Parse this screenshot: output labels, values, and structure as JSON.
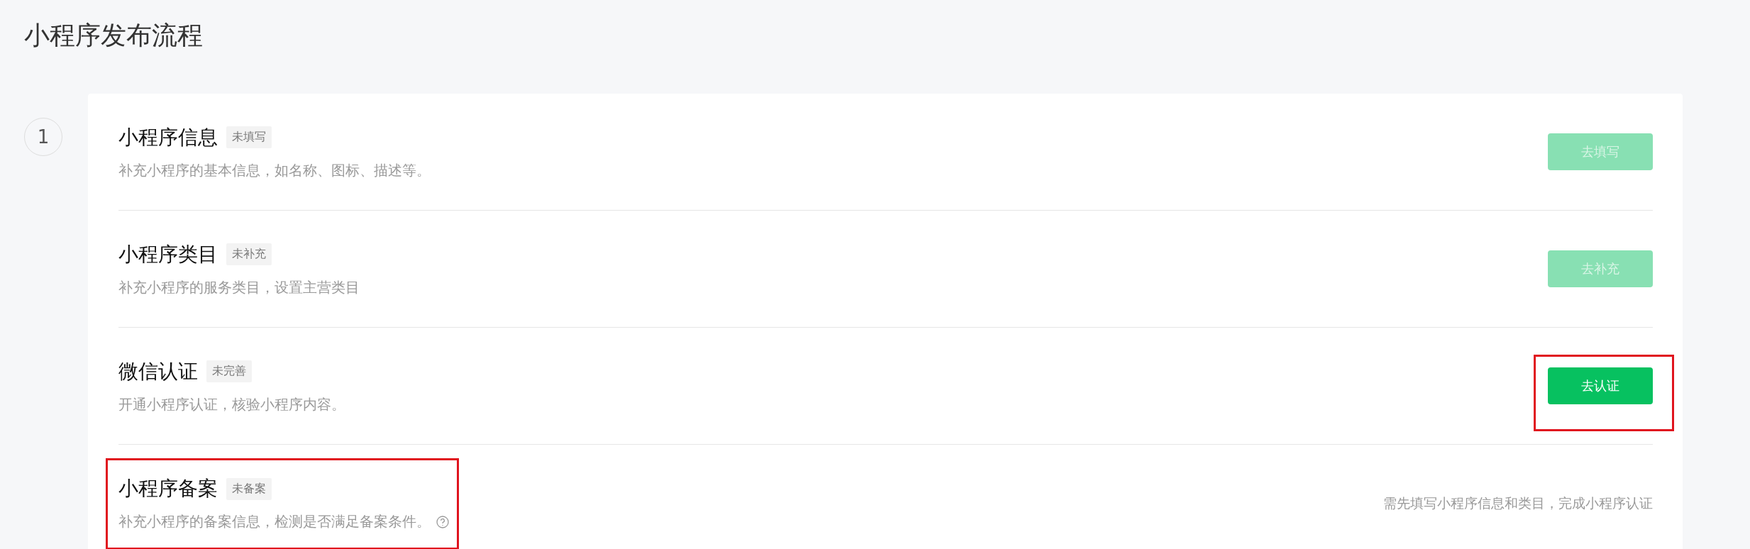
{
  "page_title": "小程序发布流程",
  "step_number": "1",
  "steps": [
    {
      "title": "小程序信息",
      "status": "未填写",
      "description": "补充小程序的基本信息，如名称、图标、描述等。",
      "kind": "button",
      "action": "去填写",
      "disabled": true,
      "help": false,
      "highlighted": false,
      "action_highlighted": false
    },
    {
      "title": "小程序类目",
      "status": "未补充",
      "description": "补充小程序的服务类目，设置主营类目",
      "kind": "button",
      "action": "去补充",
      "disabled": true,
      "help": false,
      "highlighted": false,
      "action_highlighted": false
    },
    {
      "title": "微信认证",
      "status": "未完善",
      "description": "开通小程序认证，核验小程序内容。",
      "kind": "button",
      "action": "去认证",
      "disabled": false,
      "help": false,
      "highlighted": false,
      "action_highlighted": true
    },
    {
      "title": "小程序备案",
      "status": "未备案",
      "description": "补充小程序的备案信息，检测是否满足备案条件。",
      "kind": "note",
      "note": "需先填写小程序信息和类目，完成小程序认证",
      "help": true,
      "highlighted": true,
      "action_highlighted": false
    }
  ]
}
